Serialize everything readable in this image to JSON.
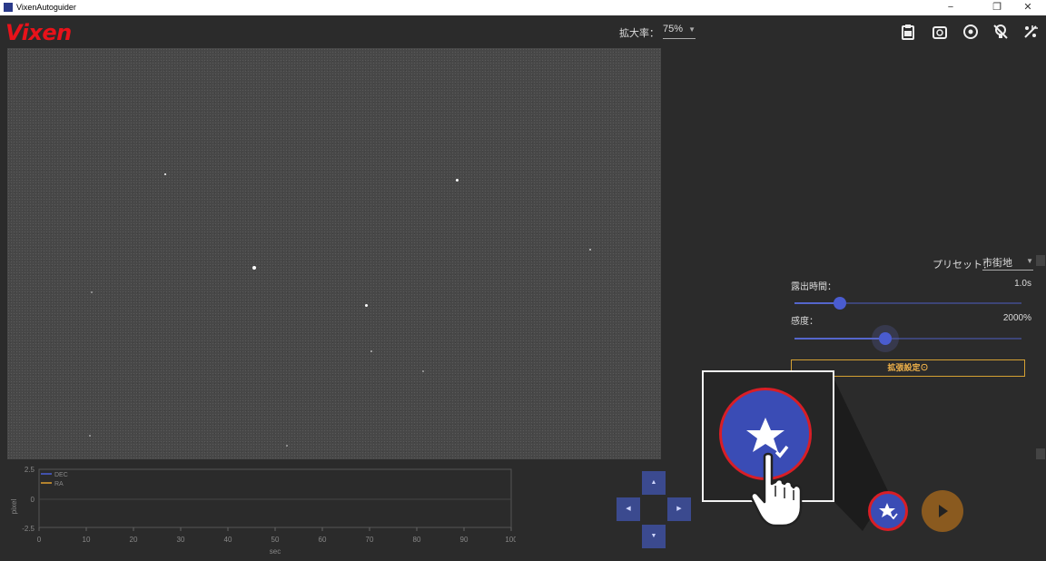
{
  "window": {
    "title": "VixenAutoguider",
    "minimize": "−",
    "restore": "❐",
    "close": "✕"
  },
  "header": {
    "logo": "Vixen",
    "zoom_label": "拡大率：",
    "zoom_value": "75%",
    "icons": [
      "clipboard-icon",
      "camera-switch-icon",
      "target-icon",
      "no-light-icon",
      "settings-icon"
    ]
  },
  "graph": {
    "y_title": "pixel",
    "x_title": "sec",
    "legend": [
      "DEC",
      "RA"
    ],
    "colors": {
      "DEC": "#4a5fd8",
      "RA": "#e0a030"
    },
    "y_ticks": [
      "2.5",
      "0",
      "-2.5"
    ],
    "x_ticks": [
      "0",
      "10",
      "20",
      "30",
      "40",
      "50",
      "60",
      "70",
      "80",
      "90",
      "100"
    ]
  },
  "settings": {
    "preset_label": "プリセット：",
    "preset_value": "市街地",
    "exposure_label": "露出時間：",
    "exposure_value": "1.0s",
    "exposure_level": 0.2,
    "gain_label": "感度：",
    "gain_value": "2000%",
    "gain_level": 0.4,
    "advanced_label": "拡張設定⊙"
  },
  "colors": {
    "accent": "#3a4cb5",
    "highlight_ring": "#d81e26",
    "play": "#8a5a1f",
    "advanced": "#f0b24a",
    "brand": "#e8121a"
  }
}
